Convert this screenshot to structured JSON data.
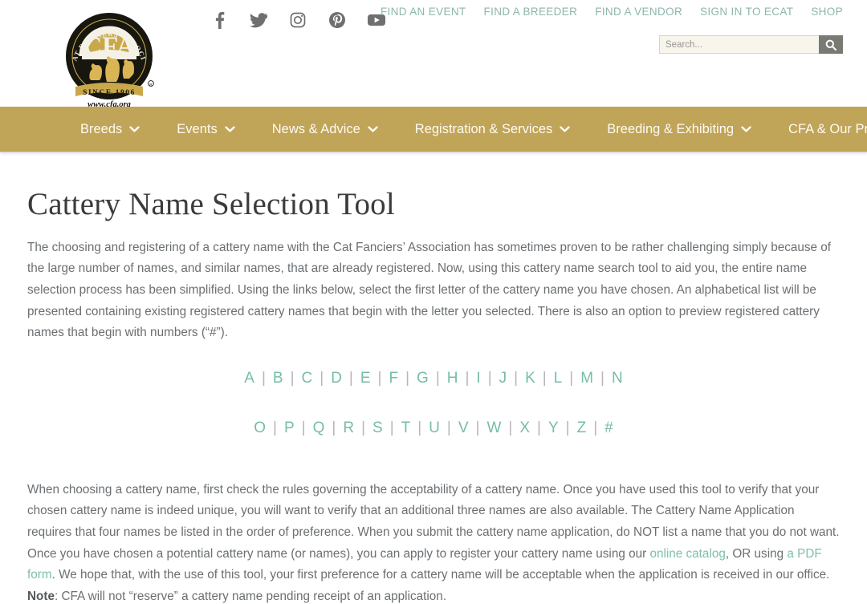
{
  "header": {
    "logo": {
      "name": "cfa-logo",
      "arc_text": "THE CAT FANCIERS' ASSOCIATION",
      "monogram": "CFA",
      "banner_text": "SINCE 1906",
      "url_text": "www.cfa.org"
    },
    "social": [
      {
        "name": "facebook-icon",
        "label": "Facebook"
      },
      {
        "name": "twitter-icon",
        "label": "Twitter"
      },
      {
        "name": "instagram-icon",
        "label": "Instagram"
      },
      {
        "name": "pinterest-icon",
        "label": "Pinterest"
      },
      {
        "name": "youtube-icon",
        "label": "YouTube"
      }
    ],
    "util_links": [
      {
        "label": "FIND AN EVENT"
      },
      {
        "label": "FIND A BREEDER"
      },
      {
        "label": "FIND A VENDOR"
      },
      {
        "label": "SIGN IN TO ECAT"
      },
      {
        "label": "SHOP"
      }
    ],
    "search": {
      "placeholder": "Search...",
      "value": "",
      "button_icon": "search-icon"
    }
  },
  "nav": {
    "items": [
      {
        "label": "Breeds",
        "has_caret": true
      },
      {
        "label": "Events",
        "has_caret": true
      },
      {
        "label": "News & Advice",
        "has_caret": true
      },
      {
        "label": "Registration & Services",
        "has_caret": true
      },
      {
        "label": "Breeding & Exhibiting",
        "has_caret": true
      },
      {
        "label": "CFA & Our Programs",
        "has_caret": true
      }
    ]
  },
  "main": {
    "title": "Cattery Name Selection Tool",
    "intro_paragraph": "The choosing and registering of a cattery name with the Cat Fanciers’ Association has sometimes proven to be rather challenging simply because of the large number of names, and similar names, that are already registered. Now, using this cattery name search tool to aid you, the entire name selection process has been simplified. Using the links below, select the first letter of the cattery name you have chosen. An alphabetical list will be presented containing existing registered cattery names that begin with the letter you selected. There is also an option to preview registered cattery names that begin with numbers (“#”).",
    "alphabet_row_1": [
      "A",
      "B",
      "C",
      "D",
      "E",
      "F",
      "G",
      "H",
      "I",
      "J",
      "K",
      "L",
      "M",
      "N"
    ],
    "alphabet_row_2": [
      "O",
      "P",
      "Q",
      "R",
      "S",
      "T",
      "U",
      "V",
      "W",
      "X",
      "Y",
      "Z",
      "#"
    ],
    "alphabet_separator": "|",
    "closing_paragraph": {
      "part_1": "When choosing a cattery name, first check the rules governing the acceptability of a cattery name. Once you have used this tool to verify that your chosen cattery name is indeed unique, you will want to verify that an additional three names are also available. The Cattery Name Application requires that four names be listed in the order of preference. When you submit the cattery name application, do NOT list a name that you do not want. Once you have chosen a potential cattery name (or names), you can apply to register your cattery name using our ",
      "link_1": "online catalog",
      "part_2": ", OR using ",
      "link_2": "a PDF form",
      "part_3": ". We hope that, with the use of this tool, your first preference for a cattery name will be acceptable when the application is received in our office. ",
      "note_label": "Note",
      "part_4": ": CFA will not “reserve” a cattery name pending receipt of an application."
    }
  },
  "colors": {
    "nav_gold": "#c0a457",
    "link_teal": "#7cc0ac",
    "util_link_teal": "#8db6ad",
    "body_text": "#6b6f72",
    "title_text": "#3b3b3b",
    "search_bg": "#f7f5ec",
    "search_button": "#7a7a74"
  }
}
